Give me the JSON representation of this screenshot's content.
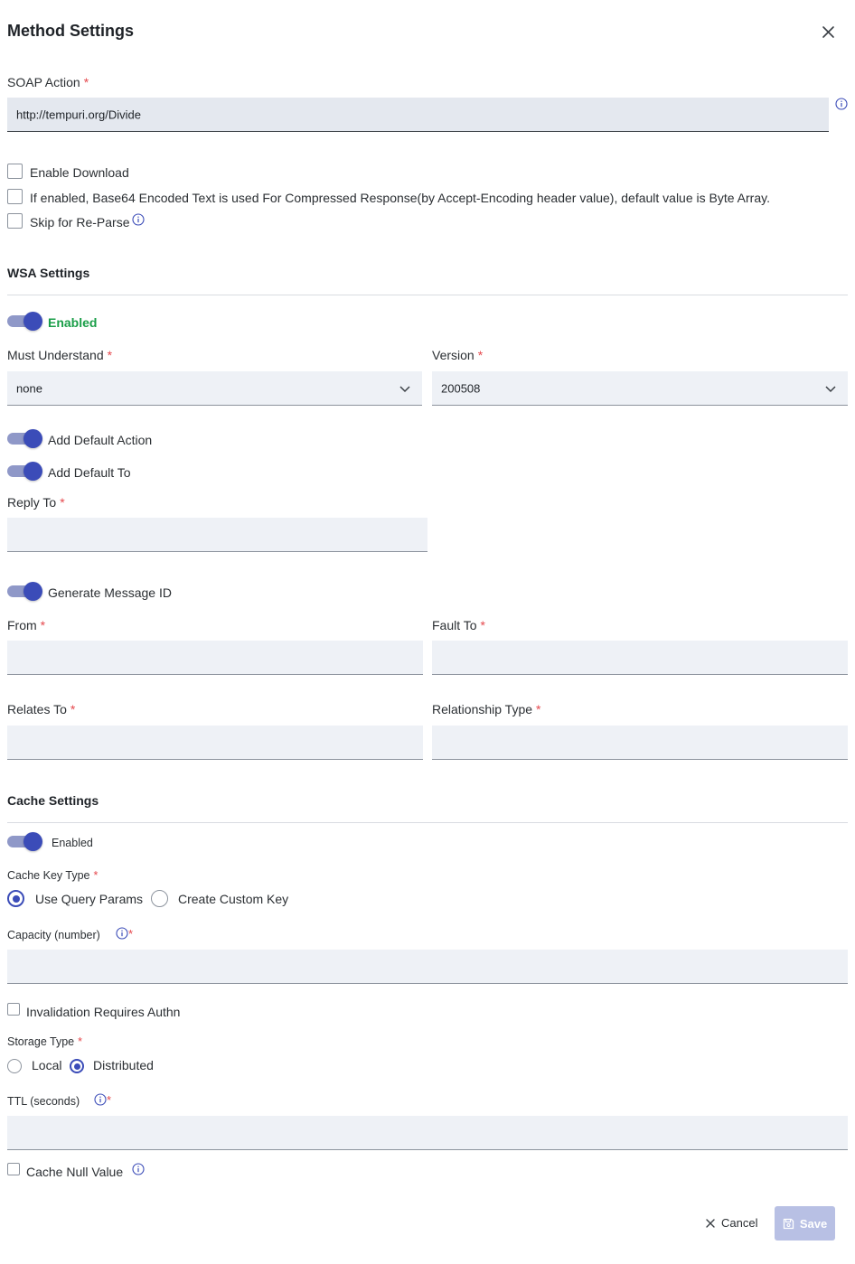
{
  "dialog": {
    "title": "Method Settings"
  },
  "soap": {
    "label": "SOAP Action",
    "value": "http://tempuri.org/Divide"
  },
  "options": {
    "enable_download": "Enable Download",
    "base64": "If enabled, Base64 Encoded Text is used For Compressed Response(by Accept-Encoding header value), default value is Byte Array.",
    "skip_reparse": "Skip for Re-Parse"
  },
  "wsa": {
    "title": "WSA Settings",
    "enabled_label": "Enabled",
    "must_understand": {
      "label": "Must Understand",
      "value": "none"
    },
    "version": {
      "label": "Version",
      "value": "200508"
    },
    "add_default_action": "Add Default Action",
    "add_default_to": "Add Default To",
    "reply_to": "Reply To",
    "generate_message_id": "Generate Message ID",
    "from": "From",
    "fault_to": "Fault To",
    "relates_to": "Relates To",
    "relationship_type": "Relationship Type"
  },
  "cache": {
    "title": "Cache Settings",
    "enabled_label": "Enabled",
    "key_type_label": "Cache Key Type",
    "key_type_options": [
      "Use Query Params",
      "Create Custom Key"
    ],
    "key_type_selected": "Use Query Params",
    "capacity_label": "Capacity (number)",
    "invalidation": "Invalidation Requires Authn",
    "storage_label": "Storage Type",
    "storage_options": [
      "Local",
      "Distributed"
    ],
    "storage_selected": "Distributed",
    "ttl_label": "TTL (seconds)",
    "null_value": "Cache Null Value"
  },
  "footer": {
    "cancel": "Cancel",
    "save": "Save"
  },
  "colors": {
    "accent": "#3b4cb8",
    "enabled_green": "#1a9e48",
    "required": "#e5484d",
    "info": "#3b4cb8",
    "save_disabled": "#b8c0e4"
  }
}
